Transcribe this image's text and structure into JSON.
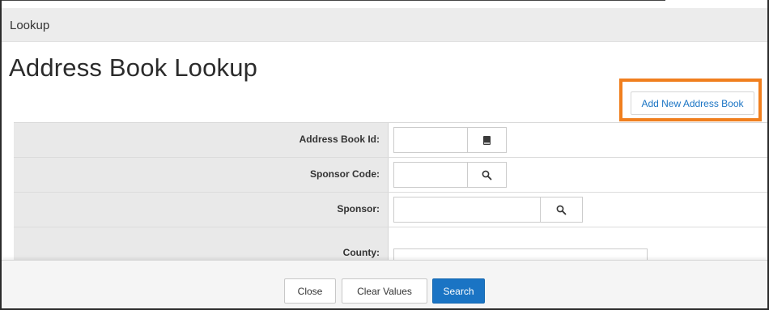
{
  "header": {
    "title": "Lookup"
  },
  "page": {
    "title": "Address Book Lookup"
  },
  "actions": {
    "add_new_label": "Add New Address Book"
  },
  "form": {
    "rows": [
      {
        "label": "Address Book Id:",
        "value": "",
        "button_icon": "book-icon"
      },
      {
        "label": "Sponsor Code:",
        "value": "",
        "button_icon": "search-icon"
      },
      {
        "label": "Sponsor:",
        "value": "",
        "button_icon": "search-icon"
      },
      {
        "label": "County:",
        "value": ""
      }
    ]
  },
  "footer": {
    "close_label": "Close",
    "clear_label": "Clear Values",
    "search_label": "Search"
  },
  "colors": {
    "accent": "#1a74c4",
    "highlight": "#f07f1e",
    "header_bg": "#ececec",
    "label_bg": "#e9e9e9"
  }
}
